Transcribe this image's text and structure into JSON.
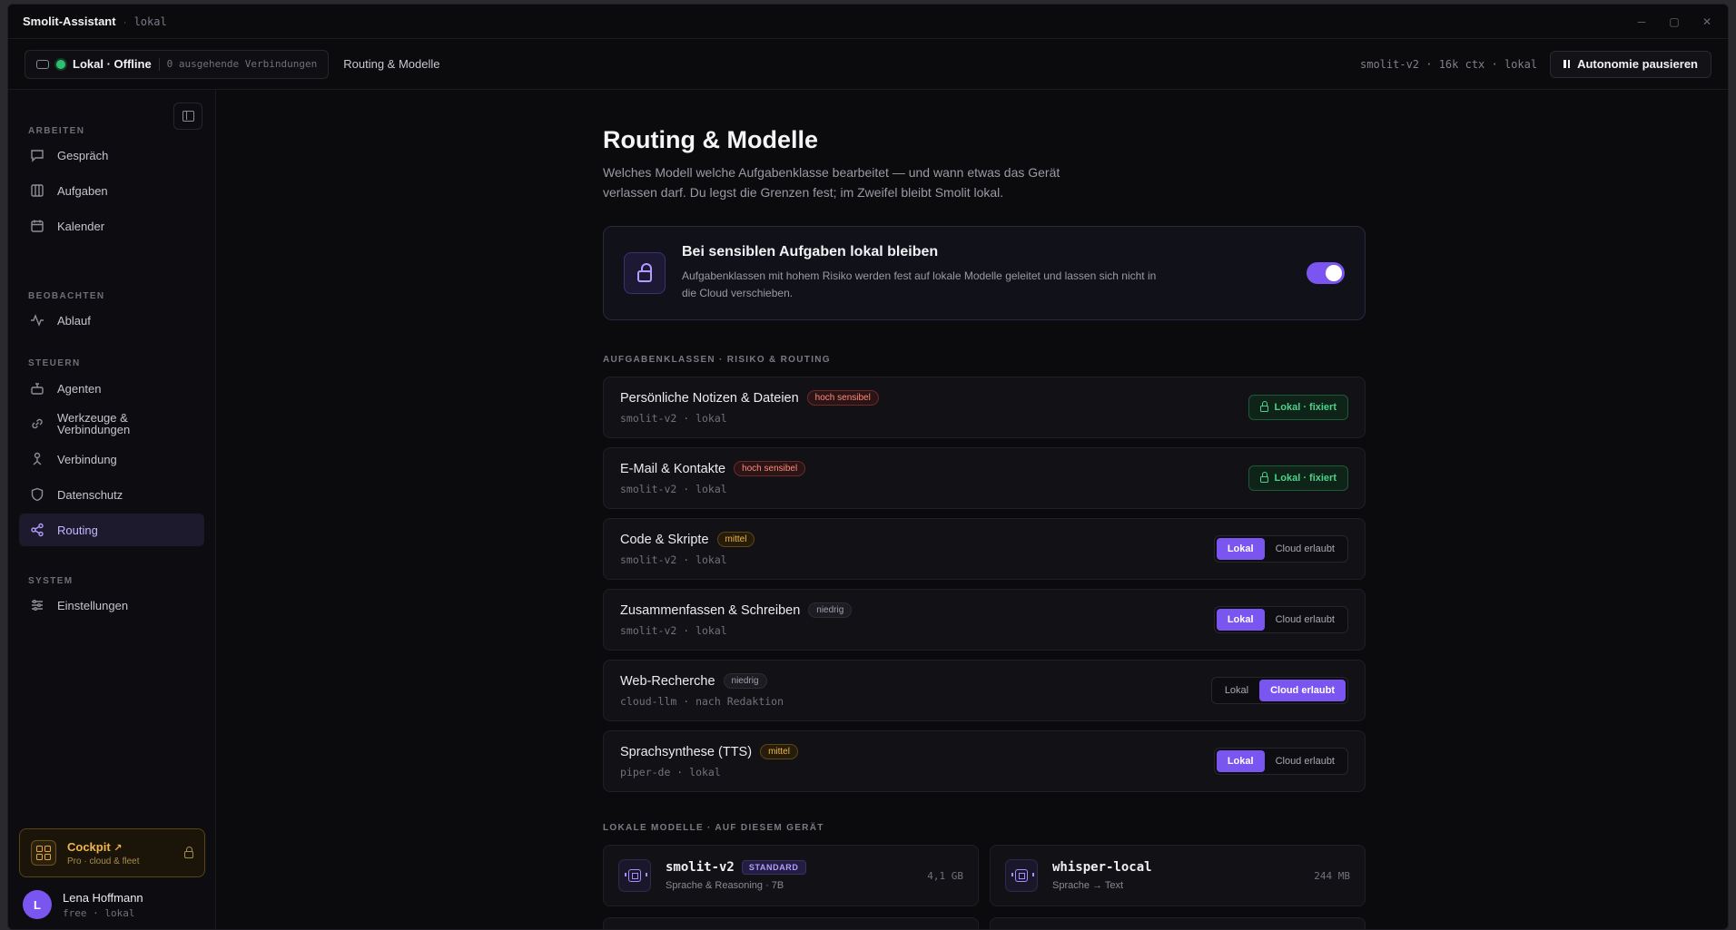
{
  "window": {
    "app_title": "Smolit-Assistant",
    "app_sub": "lokal"
  },
  "topbar": {
    "status": "Lokal · Offline",
    "outgoing": "0 ausgehende Verbindungen",
    "breadcrumb": "Routing & Modelle",
    "model_info": "smolit-v2 · 16k ctx · lokal",
    "pause_label": "Autonomie pausieren"
  },
  "sidebar": {
    "sections": [
      "ARBEITEN",
      "BEOBACHTEN",
      "STEUERN",
      "SYSTEM"
    ],
    "items": [
      {
        "label": "Gespräch"
      },
      {
        "label": "Aufgaben"
      },
      {
        "label": "Kalender"
      },
      {
        "label": "Ablauf"
      },
      {
        "label": "Agenten"
      },
      {
        "label": "Werkzeuge &"
      },
      {
        "label": "Verbindungen"
      },
      {
        "label": "Verbindung"
      },
      {
        "label": "Datenschutz"
      },
      {
        "label": "Routing"
      },
      {
        "label": "Einstellungen"
      }
    ],
    "cockpit": {
      "title": "Cockpit",
      "arrow": "↗",
      "sub": "Pro · cloud & fleet"
    },
    "user": {
      "initial": "L",
      "name": "Lena Hoffmann",
      "plan": "free · lokal"
    }
  },
  "page": {
    "title": "Routing & Modelle",
    "lead": "Welches Modell welche Aufgabenklasse bearbeitet — und wann etwas das Gerät verlassen darf. Du legst die Grenzen fest; im Zweifel bleibt Smolit lokal.",
    "sensitive": {
      "title": "Bei sensiblen Aufgaben lokal bleiben",
      "desc": "Aufgabenklassen mit hohem Risiko werden fest auf lokale Modelle geleitet und lassen sich nicht in die Cloud verschieben.",
      "enabled": true
    },
    "classes_label": "AUFGABENKLASSEN · RISIKO & ROUTING",
    "fixed_label": "Lokal · fixiert",
    "seg_local": "Lokal",
    "seg_cloud": "Cloud erlaubt",
    "classes": [
      {
        "name": "Persönliche Notizen & Dateien",
        "risk": "hoch sensibel",
        "model": "smolit-v2 · lokal"
      },
      {
        "name": "E-Mail & Kontakte",
        "risk": "hoch sensibel",
        "model": "smolit-v2 · lokal"
      },
      {
        "name": "Code & Skripte",
        "risk": "mittel",
        "model": "smolit-v2 · lokal"
      },
      {
        "name": "Zusammenfassen & Schreiben",
        "risk": "niedrig",
        "model": "smolit-v2 · lokal"
      },
      {
        "name": "Web-Recherche",
        "risk": "niedrig",
        "model": "cloud-llm · nach Redaktion"
      },
      {
        "name": "Sprachsynthese (TTS)",
        "risk": "mittel",
        "model": "piper-de · lokal"
      }
    ],
    "models_label": "LOKALE MODELLE · AUF DIESEM GERÄT",
    "models": [
      {
        "name": "smolit-v2",
        "badge": "STANDARD",
        "desc": "Sprache & Reasoning · 7B",
        "size": "4,1 GB"
      },
      {
        "name": "whisper-local",
        "desc": "Sprache → Text",
        "size": "244 MB"
      }
    ]
  }
}
